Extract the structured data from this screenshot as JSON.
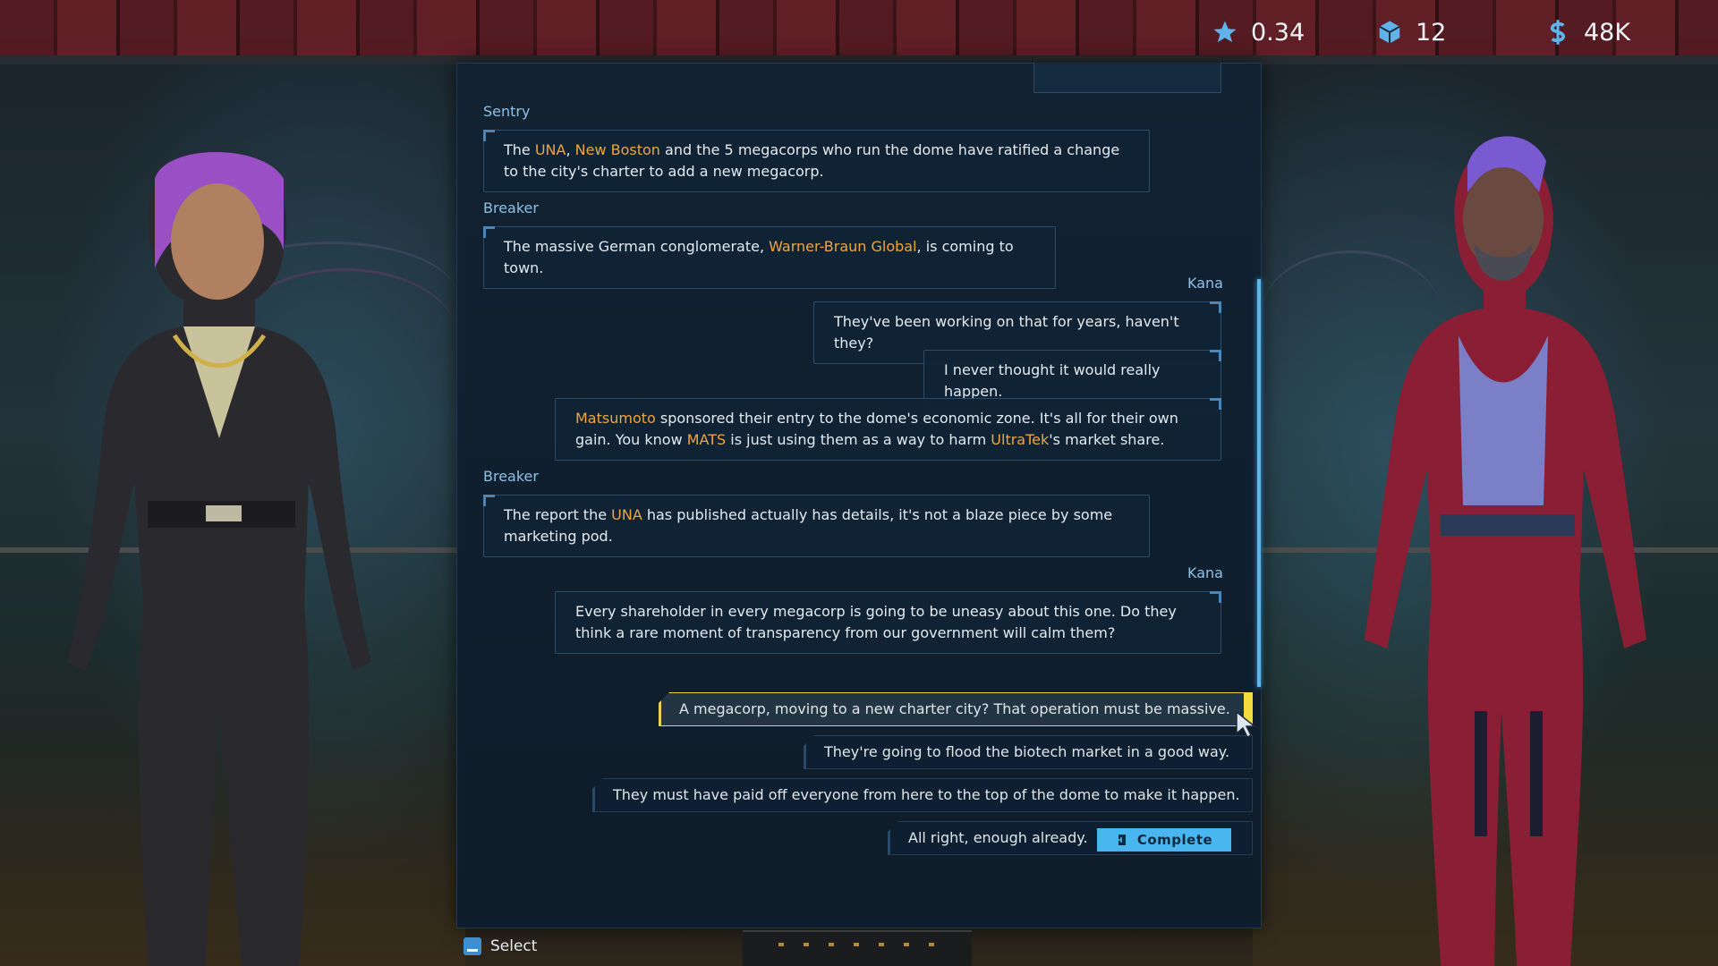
{
  "hud": {
    "rating": {
      "icon": "star-icon",
      "value": "0.34"
    },
    "cubes": {
      "icon": "cube-icon",
      "value": "12"
    },
    "credits": {
      "icon": "credits-icon",
      "value": "48K"
    }
  },
  "conversation": [
    {
      "speaker": "Sentry",
      "segments": [
        {
          "text": "The "
        },
        {
          "text": "UNA",
          "highlight": true
        },
        {
          "text": ", "
        },
        {
          "text": "New Boston",
          "highlight": true
        },
        {
          "text": " and the 5 megacorps who run the dome have ratified a change to the city's charter to add a new megacorp."
        }
      ]
    },
    {
      "speaker": "Breaker",
      "segments": [
        {
          "text": "The massive German conglomerate, "
        },
        {
          "text": "Warner-Braun Global",
          "highlight": true
        },
        {
          "text": ", is coming to town."
        }
      ]
    },
    {
      "speaker": "Kana",
      "segments": [
        {
          "text": "They've been working on that for years, haven't they?"
        }
      ]
    },
    {
      "speaker": "",
      "segments": [
        {
          "text": "I never thought it would really happen."
        }
      ]
    },
    {
      "speaker": "",
      "segments": [
        {
          "text": "Matsumoto",
          "highlight": true
        },
        {
          "text": " sponsored their entry to the dome's economic zone. It's all for their own gain. You know "
        },
        {
          "text": "MATS",
          "highlight": true
        },
        {
          "text": " is just using them as a way to harm "
        },
        {
          "text": "UltraTek",
          "highlight": true
        },
        {
          "text": "'s market share."
        }
      ]
    },
    {
      "speaker": "Breaker",
      "segments": [
        {
          "text": "The report the "
        },
        {
          "text": "UNA",
          "highlight": true
        },
        {
          "text": " has published actually has details, it's not a blaze piece by some marketing pod."
        }
      ]
    },
    {
      "speaker": "Kana",
      "segments": [
        {
          "text": "Every shareholder in every megacorp is going to be uneasy about this one. Do they think a rare moment of transparency from our government will calm them?"
        }
      ]
    }
  ],
  "responses": [
    {
      "label": "A megacorp, moving to a new charter city? That operation must be massive.",
      "selected": true
    },
    {
      "label": "They're going to flood the biotech market in a good way.",
      "selected": false
    },
    {
      "label": "They must have paid off everyone from here to the top of the dome to make it happen.",
      "selected": false
    },
    {
      "label": "All right, enough already.",
      "selected": false,
      "tag": "Complete"
    }
  ],
  "prompt": {
    "icon": "select-key-icon",
    "label": "Select"
  },
  "colors": {
    "highlight": "#f0a540",
    "accent": "#4ab6f0",
    "selected_border": "#e8d24a"
  }
}
